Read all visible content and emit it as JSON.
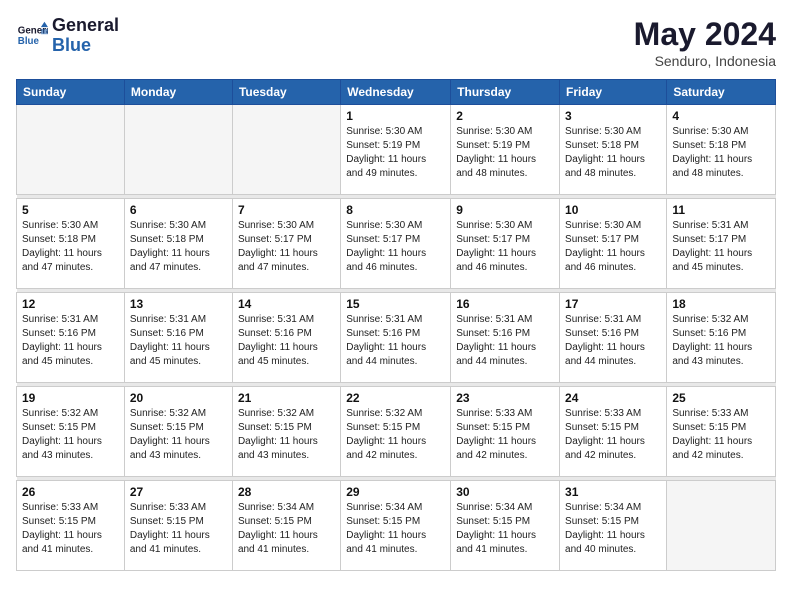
{
  "header": {
    "logo_line1": "General",
    "logo_line2": "Blue",
    "month": "May 2024",
    "location": "Senduro, Indonesia"
  },
  "weekdays": [
    "Sunday",
    "Monday",
    "Tuesday",
    "Wednesday",
    "Thursday",
    "Friday",
    "Saturday"
  ],
  "weeks": [
    [
      {
        "day": "",
        "info": ""
      },
      {
        "day": "",
        "info": ""
      },
      {
        "day": "",
        "info": ""
      },
      {
        "day": "1",
        "info": "Sunrise: 5:30 AM\nSunset: 5:19 PM\nDaylight: 11 hours\nand 49 minutes."
      },
      {
        "day": "2",
        "info": "Sunrise: 5:30 AM\nSunset: 5:19 PM\nDaylight: 11 hours\nand 48 minutes."
      },
      {
        "day": "3",
        "info": "Sunrise: 5:30 AM\nSunset: 5:18 PM\nDaylight: 11 hours\nand 48 minutes."
      },
      {
        "day": "4",
        "info": "Sunrise: 5:30 AM\nSunset: 5:18 PM\nDaylight: 11 hours\nand 48 minutes."
      }
    ],
    [
      {
        "day": "5",
        "info": "Sunrise: 5:30 AM\nSunset: 5:18 PM\nDaylight: 11 hours\nand 47 minutes."
      },
      {
        "day": "6",
        "info": "Sunrise: 5:30 AM\nSunset: 5:18 PM\nDaylight: 11 hours\nand 47 minutes."
      },
      {
        "day": "7",
        "info": "Sunrise: 5:30 AM\nSunset: 5:17 PM\nDaylight: 11 hours\nand 47 minutes."
      },
      {
        "day": "8",
        "info": "Sunrise: 5:30 AM\nSunset: 5:17 PM\nDaylight: 11 hours\nand 46 minutes."
      },
      {
        "day": "9",
        "info": "Sunrise: 5:30 AM\nSunset: 5:17 PM\nDaylight: 11 hours\nand 46 minutes."
      },
      {
        "day": "10",
        "info": "Sunrise: 5:30 AM\nSunset: 5:17 PM\nDaylight: 11 hours\nand 46 minutes."
      },
      {
        "day": "11",
        "info": "Sunrise: 5:31 AM\nSunset: 5:17 PM\nDaylight: 11 hours\nand 45 minutes."
      }
    ],
    [
      {
        "day": "12",
        "info": "Sunrise: 5:31 AM\nSunset: 5:16 PM\nDaylight: 11 hours\nand 45 minutes."
      },
      {
        "day": "13",
        "info": "Sunrise: 5:31 AM\nSunset: 5:16 PM\nDaylight: 11 hours\nand 45 minutes."
      },
      {
        "day": "14",
        "info": "Sunrise: 5:31 AM\nSunset: 5:16 PM\nDaylight: 11 hours\nand 45 minutes."
      },
      {
        "day": "15",
        "info": "Sunrise: 5:31 AM\nSunset: 5:16 PM\nDaylight: 11 hours\nand 44 minutes."
      },
      {
        "day": "16",
        "info": "Sunrise: 5:31 AM\nSunset: 5:16 PM\nDaylight: 11 hours\nand 44 minutes."
      },
      {
        "day": "17",
        "info": "Sunrise: 5:31 AM\nSunset: 5:16 PM\nDaylight: 11 hours\nand 44 minutes."
      },
      {
        "day": "18",
        "info": "Sunrise: 5:32 AM\nSunset: 5:16 PM\nDaylight: 11 hours\nand 43 minutes."
      }
    ],
    [
      {
        "day": "19",
        "info": "Sunrise: 5:32 AM\nSunset: 5:15 PM\nDaylight: 11 hours\nand 43 minutes."
      },
      {
        "day": "20",
        "info": "Sunrise: 5:32 AM\nSunset: 5:15 PM\nDaylight: 11 hours\nand 43 minutes."
      },
      {
        "day": "21",
        "info": "Sunrise: 5:32 AM\nSunset: 5:15 PM\nDaylight: 11 hours\nand 43 minutes."
      },
      {
        "day": "22",
        "info": "Sunrise: 5:32 AM\nSunset: 5:15 PM\nDaylight: 11 hours\nand 42 minutes."
      },
      {
        "day": "23",
        "info": "Sunrise: 5:33 AM\nSunset: 5:15 PM\nDaylight: 11 hours\nand 42 minutes."
      },
      {
        "day": "24",
        "info": "Sunrise: 5:33 AM\nSunset: 5:15 PM\nDaylight: 11 hours\nand 42 minutes."
      },
      {
        "day": "25",
        "info": "Sunrise: 5:33 AM\nSunset: 5:15 PM\nDaylight: 11 hours\nand 42 minutes."
      }
    ],
    [
      {
        "day": "26",
        "info": "Sunrise: 5:33 AM\nSunset: 5:15 PM\nDaylight: 11 hours\nand 41 minutes."
      },
      {
        "day": "27",
        "info": "Sunrise: 5:33 AM\nSunset: 5:15 PM\nDaylight: 11 hours\nand 41 minutes."
      },
      {
        "day": "28",
        "info": "Sunrise: 5:34 AM\nSunset: 5:15 PM\nDaylight: 11 hours\nand 41 minutes."
      },
      {
        "day": "29",
        "info": "Sunrise: 5:34 AM\nSunset: 5:15 PM\nDaylight: 11 hours\nand 41 minutes."
      },
      {
        "day": "30",
        "info": "Sunrise: 5:34 AM\nSunset: 5:15 PM\nDaylight: 11 hours\nand 41 minutes."
      },
      {
        "day": "31",
        "info": "Sunrise: 5:34 AM\nSunset: 5:15 PM\nDaylight: 11 hours\nand 40 minutes."
      },
      {
        "day": "",
        "info": ""
      }
    ]
  ]
}
